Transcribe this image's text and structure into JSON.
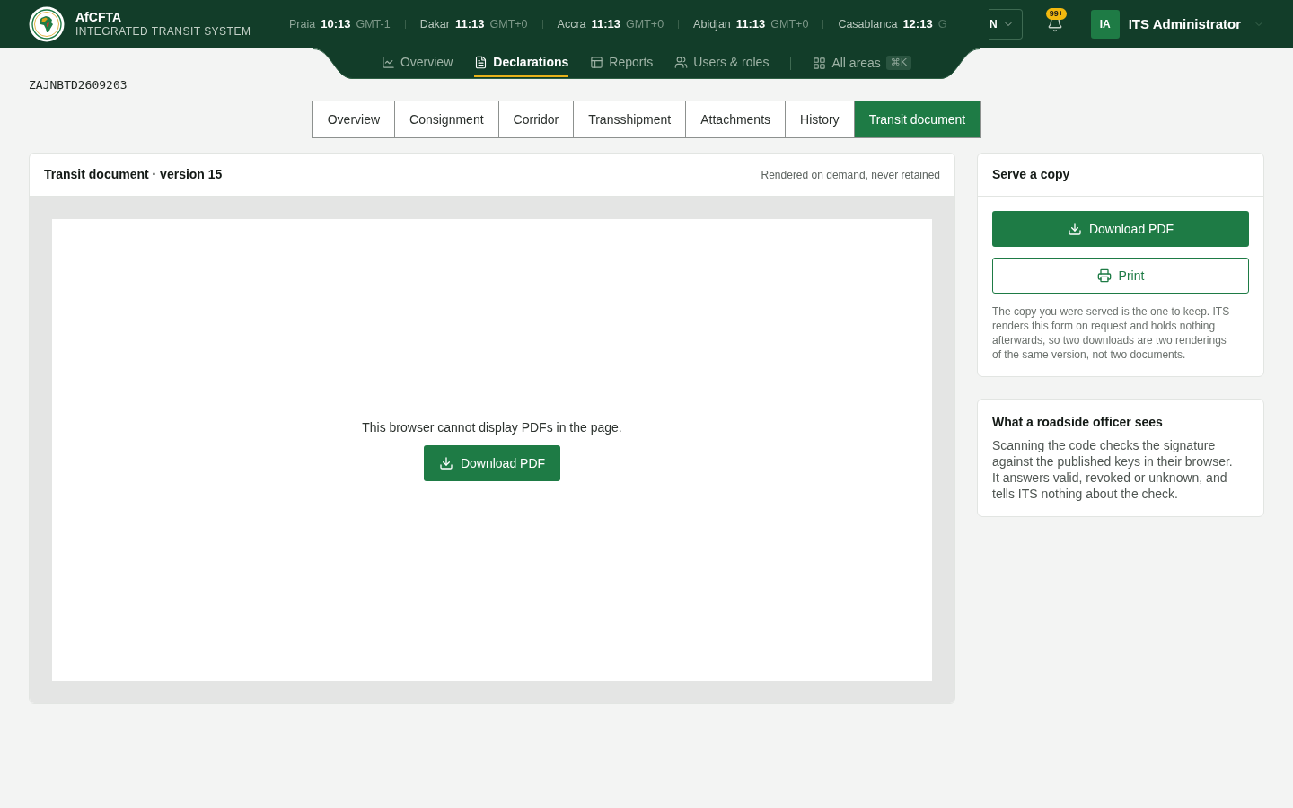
{
  "header": {
    "app_name": "AfCFTA",
    "app_subtitle": "INTEGRATED TRANSIT SYSTEM",
    "clocks": [
      {
        "city": "Praia",
        "time": "10:13",
        "zone": "GMT-1"
      },
      {
        "city": "Dakar",
        "time": "11:13",
        "zone": "GMT+0"
      },
      {
        "city": "Accra",
        "time": "11:13",
        "zone": "GMT+0"
      },
      {
        "city": "Abidjan",
        "time": "11:13",
        "zone": "GMT+0"
      },
      {
        "city": "Casablanca",
        "time": "12:13",
        "zone": "G"
      }
    ],
    "language_select": "N",
    "notification_count": "99+",
    "user": {
      "initials": "IA",
      "name": "ITS Administrator"
    }
  },
  "nav": {
    "items": [
      {
        "label": "Overview",
        "selected": false
      },
      {
        "label": "Declarations",
        "selected": true
      },
      {
        "label": "Reports",
        "selected": false
      },
      {
        "label": "Users & roles",
        "selected": false
      }
    ],
    "all_areas": {
      "label": "All areas",
      "shortcut": "⌘K"
    }
  },
  "reference": "ZAJNBTD2609203",
  "tabs": [
    {
      "label": "Overview",
      "selected": false
    },
    {
      "label": "Consignment",
      "selected": false
    },
    {
      "label": "Corridor",
      "selected": false
    },
    {
      "label": "Transshipment",
      "selected": false
    },
    {
      "label": "Attachments",
      "selected": false
    },
    {
      "label": "History",
      "selected": false
    },
    {
      "label": "Transit document",
      "selected": true
    }
  ],
  "document_panel": {
    "title": "Transit document · version 15",
    "note": "Rendered on demand, never retained",
    "fallback_message": "This browser cannot display PDFs in the page.",
    "download_button": "Download PDF"
  },
  "serve_copy": {
    "title": "Serve a copy",
    "download_button": "Download PDF",
    "print_button": "Print",
    "note": "The copy you were served is the one to keep. ITS renders this form on request and holds nothing afterwards, so two downloads are two renderings of the same version, not two documents."
  },
  "officer_info": {
    "title": "What a roadside officer sees",
    "text": "Scanning the code checks the signature against the published keys in their browser. It answers valid, revoked or unknown, and tells ITS nothing about the check."
  }
}
